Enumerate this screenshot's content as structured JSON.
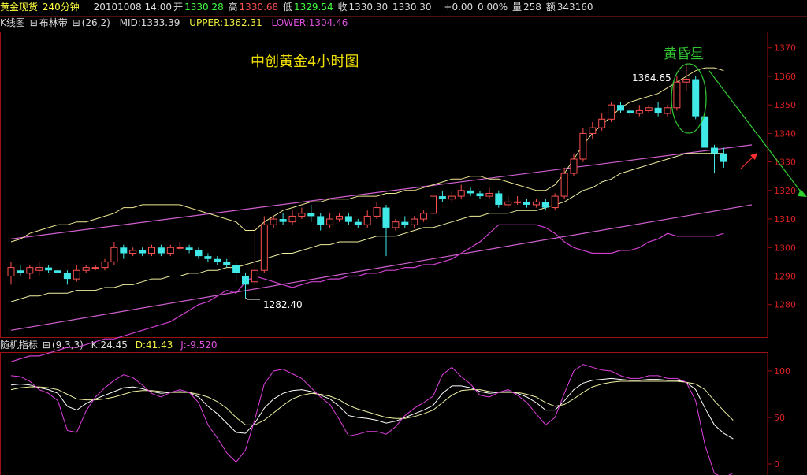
{
  "header": {
    "symbol": "黄金现货",
    "period": "240分钟",
    "date_time": "20101008 14:00",
    "open_label": "开",
    "open_value": "1330.28",
    "high_label": "高",
    "high_value": "1330.68",
    "low_label": "低",
    "low_value": "1329.54",
    "close_label": "收",
    "close_value": "1330.30",
    "last_value": "1330.30",
    "change": "+0.00",
    "change_pct": "0.00%",
    "volume_label": "量",
    "volume_value": "258",
    "amount_label": "额",
    "amount_value": "343160"
  },
  "main_indicator": {
    "label": "K线图",
    "bb_label": "布林带",
    "bb_params": "(26,2)",
    "mid": "MID:1333.39",
    "upper": "UPPER:1362.31",
    "lower": "LOWER:1304.46"
  },
  "kdj_indicator": {
    "label": "随机指标",
    "params": "(9,3,3)",
    "k": "K:24.45",
    "d": "D:41.43",
    "j": "J:-9.520"
  },
  "colors": {
    "up": "#ff5050",
    "down": "#40e8e8",
    "mid_line": "#f0f0a0",
    "upper_line": "#f0e890",
    "lower_line": "#d040d0",
    "trend_line": "#d060d0",
    "axis": "#a01010",
    "annotation": "#f0e000",
    "evening_star": "#30c030"
  },
  "chart_data": [
    {
      "type": "candlestick",
      "title": "中创黄金4小时图",
      "ylim": [
        1270,
        1376
      ],
      "y_ticks": [
        1280,
        1290,
        1300,
        1310,
        1320,
        1330,
        1340,
        1350,
        1360,
        1370
      ],
      "annotations": {
        "high_label": "1364.65",
        "low_label": "1282.40",
        "pattern_label": "黄昏星"
      },
      "candles": [
        [
          1290,
          1293,
          1295,
          1287
        ],
        [
          1292,
          1291,
          1294,
          1290
        ],
        [
          1291,
          1293,
          1294,
          1289
        ],
        [
          1292,
          1293,
          1295,
          1290
        ],
        [
          1293,
          1292,
          1294,
          1291
        ],
        [
          1292,
          1291,
          1293,
          1290
        ],
        [
          1291,
          1289,
          1292,
          1287
        ],
        [
          1289,
          1292,
          1294,
          1288
        ],
        [
          1292,
          1293,
          1294,
          1291
        ],
        [
          1293,
          1293,
          1294,
          1292
        ],
        [
          1293,
          1295,
          1296,
          1292
        ],
        [
          1295,
          1300,
          1302,
          1294
        ],
        [
          1300,
          1298,
          1301,
          1296
        ],
        [
          1298,
          1299,
          1300,
          1297
        ],
        [
          1299,
          1298,
          1300,
          1297
        ],
        [
          1298,
          1300,
          1301,
          1297
        ],
        [
          1300,
          1298,
          1301,
          1297
        ],
        [
          1298,
          1300,
          1301,
          1297
        ],
        [
          1300,
          1300,
          1302,
          1299
        ],
        [
          1300,
          1299,
          1301,
          1298
        ],
        [
          1299,
          1297,
          1300,
          1296
        ],
        [
          1297,
          1296,
          1298,
          1295
        ],
        [
          1296,
          1295,
          1297,
          1294
        ],
        [
          1295,
          1294,
          1296,
          1293
        ],
        [
          1294,
          1291,
          1295,
          1288
        ],
        [
          1290,
          1287,
          1291,
          1282.4
        ],
        [
          1288,
          1292,
          1308,
          1287
        ],
        [
          1292,
          1308,
          1311,
          1291
        ],
        [
          1308,
          1310,
          1311,
          1307
        ],
        [
          1310,
          1309,
          1312,
          1308
        ],
        [
          1309,
          1311,
          1313,
          1308
        ],
        [
          1311,
          1312,
          1314,
          1310
        ],
        [
          1312,
          1311,
          1315,
          1309
        ],
        [
          1311,
          1308,
          1312,
          1306
        ],
        [
          1308,
          1310,
          1312,
          1307
        ],
        [
          1310,
          1311,
          1312,
          1309
        ],
        [
          1311,
          1309,
          1312,
          1308
        ],
        [
          1309,
          1308,
          1310,
          1307
        ],
        [
          1308,
          1311,
          1313,
          1307
        ],
        [
          1311,
          1314,
          1316,
          1310
        ],
        [
          1314,
          1307,
          1315,
          1297
        ],
        [
          1307,
          1309,
          1310,
          1306
        ],
        [
          1309,
          1308,
          1311,
          1307
        ],
        [
          1308,
          1310,
          1311,
          1307
        ],
        [
          1310,
          1312,
          1313,
          1309
        ],
        [
          1312,
          1318,
          1319,
          1311
        ],
        [
          1318,
          1317,
          1320,
          1316
        ],
        [
          1317,
          1318,
          1320,
          1316
        ],
        [
          1318,
          1320,
          1322,
          1317
        ],
        [
          1320,
          1319,
          1321,
          1318
        ],
        [
          1319,
          1318,
          1320,
          1317
        ],
        [
          1318,
          1319,
          1321,
          1317
        ],
        [
          1319,
          1315,
          1320,
          1314
        ],
        [
          1315,
          1316,
          1318,
          1314
        ],
        [
          1316,
          1316,
          1318,
          1315
        ],
        [
          1316,
          1315,
          1317,
          1314
        ],
        [
          1315,
          1316,
          1317,
          1314
        ],
        [
          1316,
          1314,
          1317,
          1313
        ],
        [
          1314,
          1318,
          1319,
          1313
        ],
        [
          1318,
          1326,
          1328,
          1317
        ],
        [
          1326,
          1331,
          1333,
          1325
        ],
        [
          1331,
          1340,
          1342,
          1330
        ],
        [
          1340,
          1342,
          1344,
          1338
        ],
        [
          1342,
          1345,
          1347,
          1341
        ],
        [
          1345,
          1350,
          1351,
          1344
        ],
        [
          1350,
          1348,
          1351,
          1347
        ],
        [
          1348,
          1347,
          1349,
          1346
        ],
        [
          1347,
          1348,
          1350,
          1346
        ],
        [
          1348,
          1349,
          1350,
          1347
        ],
        [
          1349,
          1347,
          1351,
          1346
        ],
        [
          1347,
          1349,
          1350,
          1346
        ],
        [
          1349,
          1358,
          1360,
          1348
        ],
        [
          1358,
          1359,
          1364.65,
          1355
        ],
        [
          1359,
          1346,
          1360,
          1345
        ],
        [
          1346,
          1335,
          1350,
          1334
        ],
        [
          1335,
          1333,
          1336,
          1326
        ],
        [
          1333,
          1330,
          1335,
          1328
        ]
      ],
      "bollinger": {
        "upper": [
          1302,
          1303,
          1305,
          1306,
          1307,
          1308,
          1308,
          1309,
          1309,
          1310,
          1311,
          1312,
          1314,
          1314,
          1315,
          1315,
          1315,
          1315,
          1315,
          1314,
          1313,
          1312,
          1311,
          1310,
          1309,
          1306,
          1306,
          1309,
          1311,
          1313,
          1314,
          1315,
          1316,
          1316,
          1317,
          1317,
          1317,
          1318,
          1318,
          1318,
          1319,
          1319,
          1320,
          1320,
          1321,
          1322,
          1323,
          1324,
          1324,
          1325,
          1325,
          1324,
          1324,
          1323,
          1322,
          1321,
          1320,
          1320,
          1322,
          1326,
          1331,
          1336,
          1340,
          1343,
          1346,
          1349,
          1351,
          1352,
          1353,
          1354,
          1356,
          1358,
          1360,
          1362,
          1363,
          1363,
          1362
        ],
        "mid": [
          1281,
          1282,
          1283,
          1283,
          1284,
          1284,
          1284,
          1285,
          1285,
          1285,
          1286,
          1286,
          1287,
          1287,
          1288,
          1289,
          1289,
          1290,
          1290,
          1291,
          1291,
          1292,
          1292,
          1293,
          1293,
          1294,
          1295,
          1296,
          1297,
          1298,
          1298,
          1299,
          1300,
          1301,
          1301,
          1302,
          1302,
          1302,
          1303,
          1304,
          1304,
          1304,
          1305,
          1306,
          1307,
          1307,
          1308,
          1309,
          1310,
          1311,
          1311,
          1312,
          1312,
          1312,
          1313,
          1313,
          1313,
          1314,
          1315,
          1316,
          1318,
          1320,
          1321,
          1323,
          1324,
          1326,
          1327,
          1328,
          1329,
          1330,
          1331,
          1332,
          1333,
          1333,
          1333,
          1333,
          1333
        ],
        "lower": [
          1260,
          1261,
          1262,
          1262,
          1263,
          1264,
          1265,
          1265,
          1266,
          1267,
          1268,
          1268,
          1269,
          1270,
          1271,
          1272,
          1273,
          1274,
          1276,
          1278,
          1280,
          1281,
          1283,
          1285,
          1284,
          1288,
          1290,
          1289,
          1288,
          1287,
          1286,
          1287,
          1288,
          1288,
          1289,
          1289,
          1290,
          1290,
          1291,
          1291,
          1292,
          1292,
          1293,
          1293,
          1294,
          1294,
          1295,
          1296,
          1298,
          1300,
          1302,
          1305,
          1308,
          1308,
          1308,
          1308,
          1308,
          1307,
          1305,
          1302,
          1300,
          1299,
          1298,
          1298,
          1298,
          1299,
          1299,
          1300,
          1302,
          1303,
          1305,
          1304,
          1304,
          1304,
          1304,
          1304,
          1305
        ]
      },
      "trend_lines": [
        {
          "from": [
            0,
            1303
          ],
          "to": [
            79,
            1336
          ]
        },
        {
          "from": [
            0,
            1271
          ],
          "to": [
            79,
            1315
          ]
        }
      ]
    },
    {
      "type": "line",
      "title": "随机指标 KDJ",
      "ylim": [
        -8,
        112
      ],
      "y_ticks": [
        0,
        50,
        100
      ],
      "series": [
        {
          "name": "K",
          "values": [
            85,
            86,
            85,
            82,
            80,
            76,
            62,
            58,
            65,
            70,
            74,
            78,
            82,
            83,
            81,
            78,
            76,
            77,
            78,
            77,
            72,
            62,
            54,
            44,
            34,
            33,
            44,
            60,
            70,
            76,
            79,
            80,
            78,
            74,
            70,
            62,
            52,
            50,
            49,
            47,
            44,
            46,
            50,
            54,
            58,
            63,
            76,
            84,
            84,
            82,
            78,
            76,
            77,
            78,
            76,
            72,
            66,
            58,
            58,
            68,
            80,
            87,
            90,
            91,
            92,
            91,
            90,
            90,
            91,
            91,
            90,
            90,
            88,
            80,
            60,
            42,
            33,
            27
          ]
        },
        {
          "name": "D",
          "values": [
            80,
            82,
            83,
            83,
            82,
            80,
            75,
            70,
            69,
            69,
            70,
            72,
            75,
            78,
            79,
            79,
            78,
            77,
            77,
            77,
            75,
            72,
            67,
            60,
            50,
            42,
            42,
            47,
            55,
            63,
            70,
            74,
            76,
            75,
            73,
            69,
            63,
            59,
            56,
            53,
            50,
            49,
            49,
            51,
            54,
            58,
            66,
            74,
            79,
            80,
            80,
            78,
            77,
            77,
            77,
            75,
            72,
            66,
            62,
            64,
            70,
            77,
            83,
            86,
            88,
            89,
            89,
            89,
            89,
            89,
            89,
            89,
            88,
            86,
            80,
            68,
            57,
            47
          ]
        },
        {
          "name": "J",
          "values": [
            95,
            94,
            89,
            80,
            76,
            68,
            36,
            34,
            57,
            72,
            82,
            90,
            96,
            93,
            85,
            76,
            72,
            77,
            80,
            77,
            66,
            42,
            28,
            12,
            2,
            15,
            48,
            86,
            100,
            102,
            97,
            92,
            82,
            72,
            64,
            48,
            30,
            32,
            35,
            35,
            32,
            40,
            52,
            60,
            66,
            73,
            96,
            104,
            94,
            86,
            74,
            72,
            77,
            80,
            74,
            66,
            54,
            42,
            50,
            76,
            100,
            107,
            104,
            101,
            100,
            95,
            92,
            92,
            95,
            95,
            92,
            92,
            88,
            68,
            20,
            -10,
            -15,
            -9.52
          ]
        }
      ]
    }
  ]
}
